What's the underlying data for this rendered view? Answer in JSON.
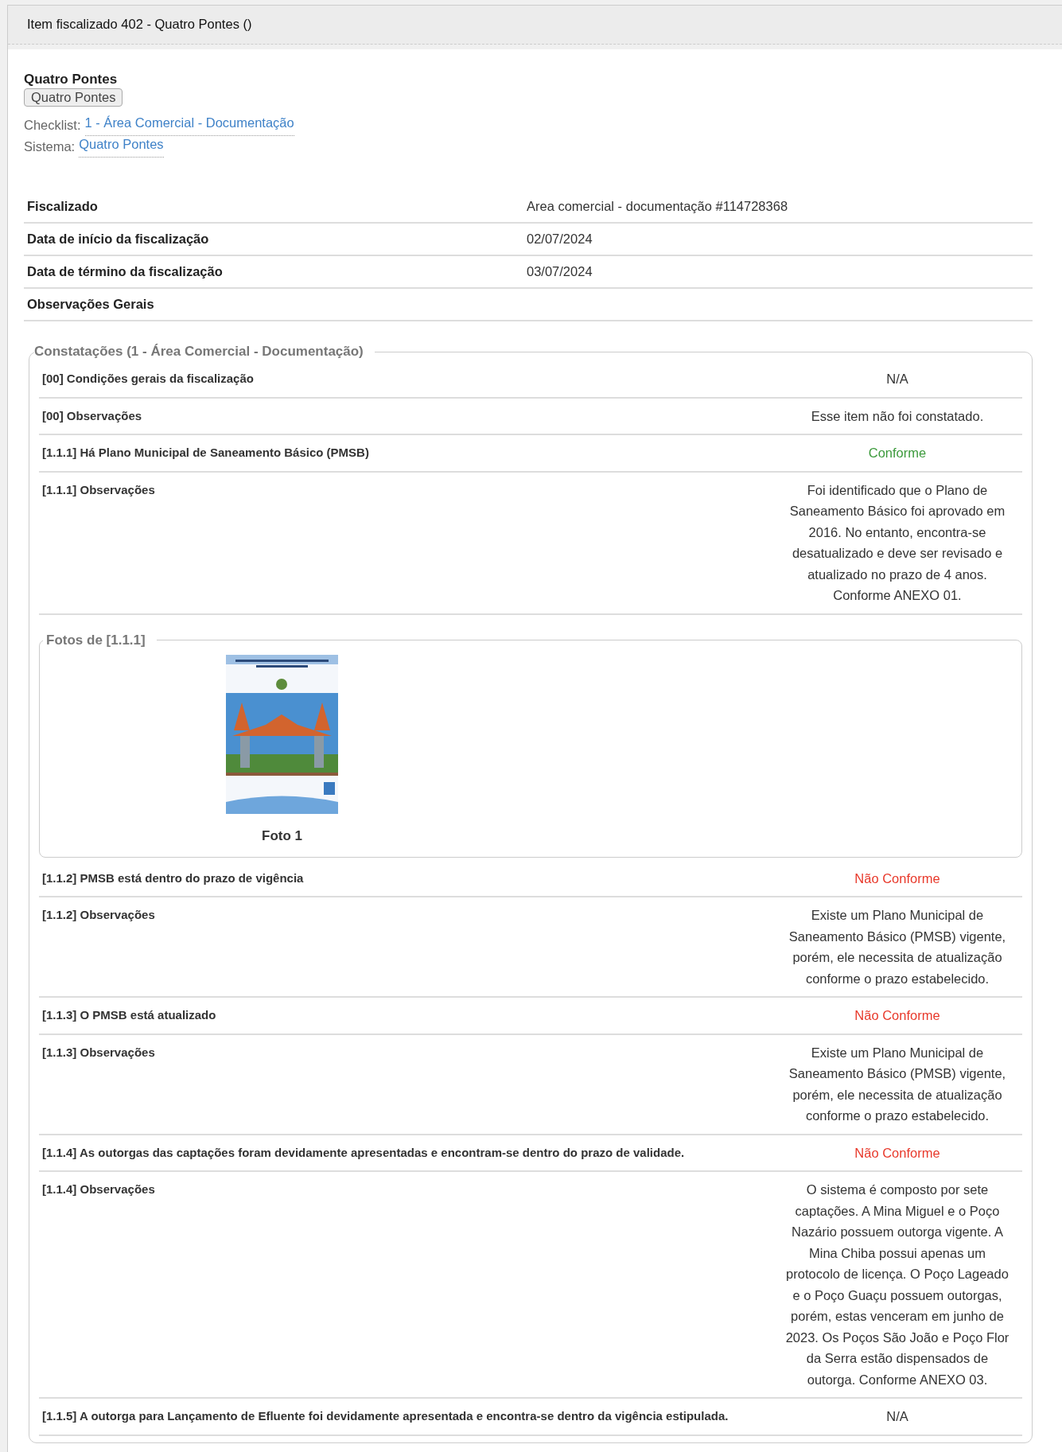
{
  "panel": {
    "title": "Item fiscalizado 402 - Quatro Pontes ()"
  },
  "heading": "Quatro Pontes",
  "tag_button": "Quatro Pontes",
  "links": [
    {
      "label": "Checklist:",
      "link": "1 - Área Comercial - Documentação"
    },
    {
      "label": "Sistema:",
      "link": "Quatro Pontes"
    }
  ],
  "details": [
    {
      "label": "Fiscalizado",
      "value": "Area comercial - documentação #114728368"
    },
    {
      "label": "Data de início da fiscalização",
      "value": "02/07/2024"
    },
    {
      "label": "Data de término da fiscalização",
      "value": "03/07/2024"
    },
    {
      "label": "Observações Gerais"
    }
  ],
  "constatacoes": {
    "legend": "Constatações (1 - Área Comercial - Documentação)",
    "items": [
      {
        "kind": "row",
        "label": "[00] Condições gerais da fiscalização",
        "value": "N/A",
        "color": "#333333"
      },
      {
        "kind": "row",
        "label": "[00] Observações",
        "value": "Esse item não foi constatado.",
        "color": "#333333"
      },
      {
        "kind": "row",
        "label": "[1.1.1] Há Plano Municipal de Saneamento Básico (PMSB)",
        "value": "Conforme",
        "color": "#3c9a3c"
      },
      {
        "kind": "row",
        "label": "[1.1.1] Observações",
        "value": "Foi identificado que o Plano de Saneamento Básico foi aprovado em 2016. No entanto, encontra-se desatualizado e deve ser revisado e atualizado no prazo de 4 anos. Conforme ANEXO 01.",
        "color": "#333333"
      },
      {
        "kind": "photos",
        "legend": "Fotos de [1.1.1]",
        "photos": [
          {
            "caption": "Foto 1"
          }
        ]
      },
      {
        "kind": "row",
        "label": "[1.1.2] PMSB está dentro do prazo de vigência",
        "value": "Não Conforme",
        "color": "#e8392b"
      },
      {
        "kind": "row",
        "label": "[1.1.2] Observações",
        "value": "Existe um Plano Municipal de Saneamento Básico (PMSB) vigente, porém, ele necessita de atualização conforme o prazo estabelecido.",
        "color": "#333333"
      },
      {
        "kind": "row",
        "label": "[1.1.3] O PMSB está atualizado",
        "value": "Não Conforme",
        "color": "#e8392b"
      },
      {
        "kind": "row",
        "label": "[1.1.3] Observações",
        "value": "Existe um Plano Municipal de Saneamento Básico (PMSB) vigente, porém, ele necessita de atualização conforme o prazo estabelecido.",
        "color": "#333333"
      },
      {
        "kind": "row",
        "label": "[1.1.4] As outorgas das captações foram devidamente apresentadas e encontram-se dentro do prazo de validade.",
        "value": "Não Conforme",
        "color": "#e8392b"
      },
      {
        "kind": "row",
        "label": "[1.1.4] Observações",
        "value": "O sistema é composto por sete captações. A Mina Miguel e o Poço Nazário possuem outorga vigente. A Mina Chiba possui apenas um protocolo de licença. O Poço Lageado e o Poço Guaçu possuem outorgas, porém, estas venceram em junho de 2023. Os Poços São João e Poço Flor da Serra estão dispensados de outorga. Conforme ANEXO 03.",
        "color": "#333333"
      },
      {
        "kind": "row",
        "label": "[1.1.5] A outorga para Lançamento de Efluente foi devidamente apresentada e encontra-se dentro da vigência estipulada.",
        "value": "N/A",
        "color": "#333333"
      }
    ]
  }
}
